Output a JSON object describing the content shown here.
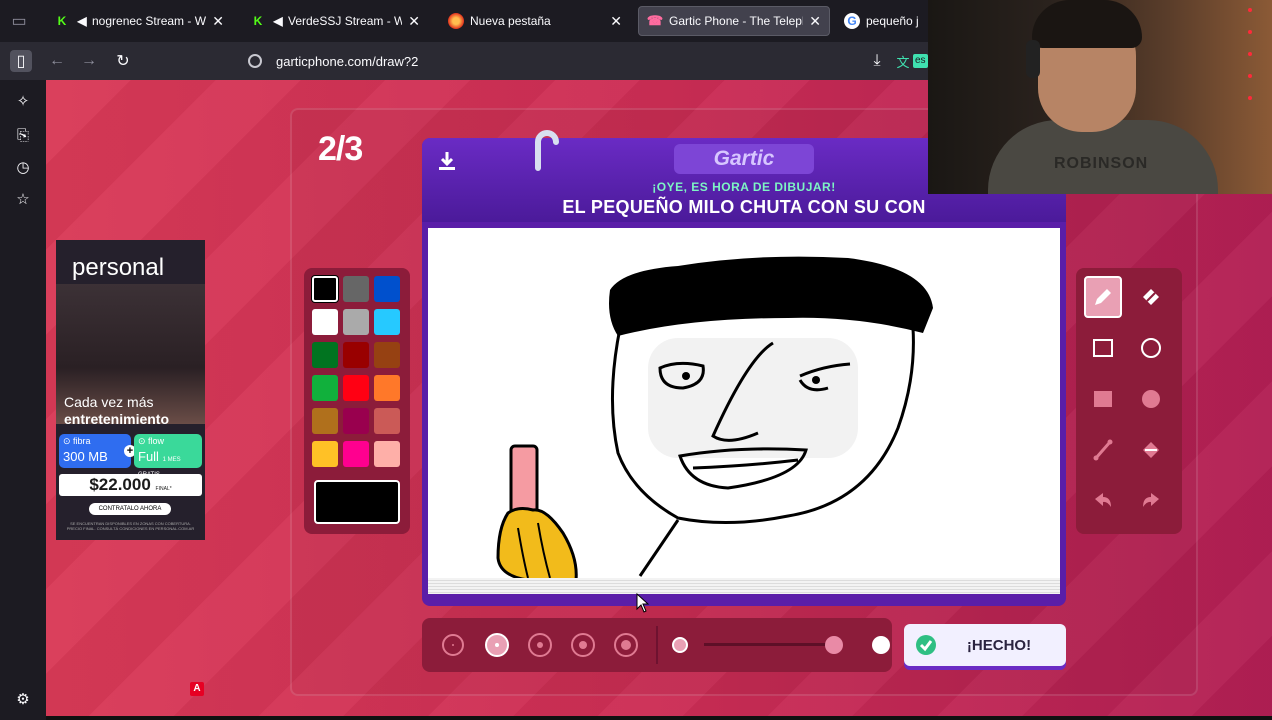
{
  "browser": {
    "tabs": [
      {
        "title": "nogrenec Stream - Watch",
        "favicon": "kick-icon",
        "muted": true,
        "active": false
      },
      {
        "title": "VerdeSSJ Stream - Watch",
        "favicon": "kick-icon",
        "muted": true,
        "active": false
      },
      {
        "title": "Nueva pestaña",
        "favicon": "firefox-icon",
        "muted": false,
        "active": false
      },
      {
        "title": "Gartic Phone - The Telephone",
        "favicon": "gartic-icon",
        "muted": false,
        "active": true
      },
      {
        "title": "pequeño j - B",
        "favicon": "google-icon",
        "muted": false,
        "active": false
      }
    ],
    "url": "garticphone.com/draw?2",
    "translate_badge": "es"
  },
  "game": {
    "round": "2/3",
    "logo": "Gartic",
    "subtitle": "¡OYE, ES HORA DE DIBUJAR!",
    "prompt": "EL PEQUEÑO MILO CHUTA CON SU CON",
    "done_label": "¡HECHO!",
    "palette": [
      "#000000",
      "#666666",
      "#0050cd",
      "#ffffff",
      "#aaaaaa",
      "#26c9ff",
      "#017420",
      "#990000",
      "#964112",
      "#11b03c",
      "#ff0013",
      "#ff7829",
      "#b0701c",
      "#99004e",
      "#cb5a57",
      "#ffc126",
      "#ff008f",
      "#feafa8"
    ],
    "selected_color": "#000000",
    "tools": [
      "pencil-icon",
      "eraser-icon",
      "rectangle-outline-icon",
      "circle-outline-icon",
      "rectangle-fill-icon",
      "circle-fill-icon",
      "line-icon",
      "bucket-icon",
      "undo-icon",
      "redo-icon"
    ],
    "selected_tool": "pencil-icon",
    "brush_sizes": 5,
    "selected_size_index": 1
  },
  "ad": {
    "brand": "personal",
    "headline_1": "Cada vez más",
    "headline_2": "entretenimiento",
    "fibra_label": "fibra",
    "fibra_speed": "300 MB",
    "flow_label": "flow",
    "flow_plan": "Full",
    "flow_note": "1 MES GRATIS",
    "price": "$22.000",
    "price_suffix": "FINAL*",
    "cta": "CONTRATALO AHORA",
    "legal": "SE ENCUENTRAN DISPONIBLES EN ZONAS CON COBERTURA. PRECIO FINAL. CONSULTÁ CONDICIONES EN PERSONAL.COM.AR"
  },
  "webcam": {
    "shirt_text": "ROBINSON"
  }
}
